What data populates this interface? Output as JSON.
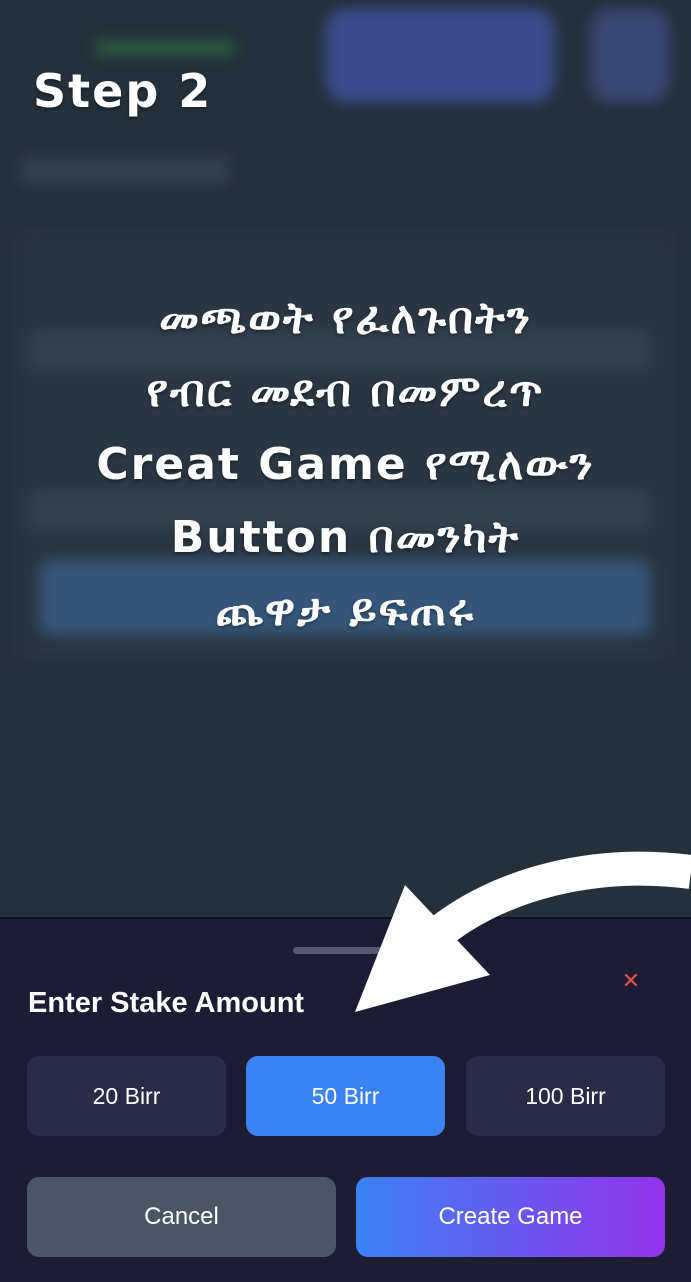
{
  "overlay": {
    "step": "Step 2",
    "instruction_lines": [
      "መጫወት የፈለጉበትን",
      "የብር መደብ በመምረጥ",
      "Creat Game የሚለውን",
      "Button በመንካት",
      "ጨዋታ ይፍጠሩ"
    ]
  },
  "sheet": {
    "title": "Enter Stake Amount",
    "close_icon": "close-icon",
    "stake_options": [
      {
        "label": "20 Birr",
        "selected": false
      },
      {
        "label": "50 Birr",
        "selected": true
      },
      {
        "label": "100 Birr",
        "selected": false
      }
    ],
    "cancel_label": "Cancel",
    "create_label": "Create Game"
  },
  "colors": {
    "selected": "#3b82f6",
    "gradient_end": "#9333ea",
    "close": "#ef4d4d",
    "sheet_bg": "#1c1d33"
  }
}
